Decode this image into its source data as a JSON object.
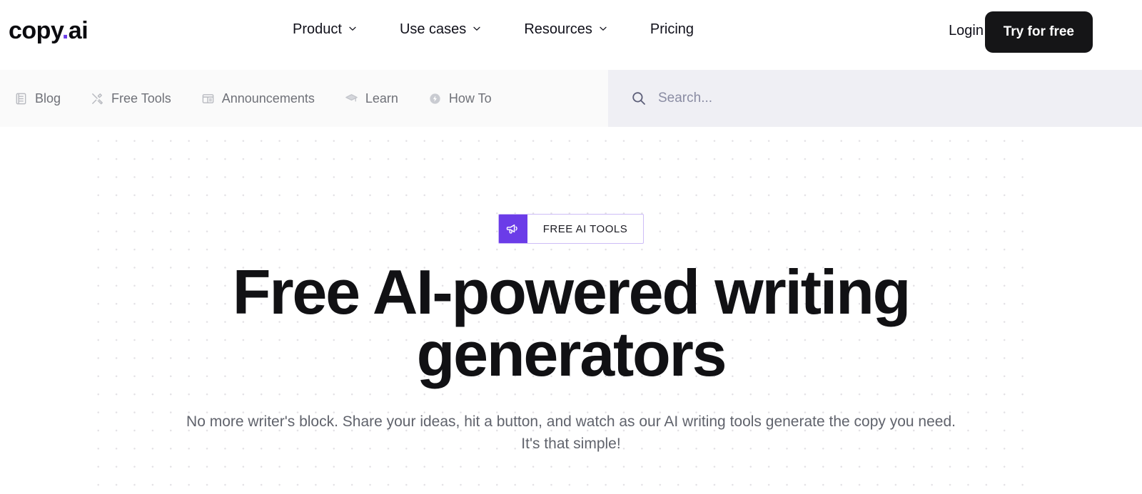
{
  "brand": {
    "name_part1": "copy",
    "dot": ".",
    "name_part2": "ai",
    "accent_color": "#6B3CE8"
  },
  "header": {
    "nav": [
      {
        "label": "Product",
        "has_chevron": true,
        "icon": "chevron-down-icon"
      },
      {
        "label": "Use cases",
        "has_chevron": true,
        "icon": "chevron-down-icon"
      },
      {
        "label": "Resources",
        "has_chevron": true,
        "icon": "chevron-down-icon"
      },
      {
        "label": "Pricing",
        "has_chevron": false,
        "icon": ""
      }
    ],
    "login_label": "Login",
    "cta_label": "Try for free",
    "cta_bg": "#151517",
    "cta_text_color": "#FFFFFF"
  },
  "subnav": {
    "background": "#FAFAFA",
    "items": [
      {
        "label": "Blog",
        "icon": "book-icon"
      },
      {
        "label": "Free Tools",
        "icon": "tools-icon"
      },
      {
        "label": "Announcements",
        "icon": "layout-icon"
      },
      {
        "label": "Learn",
        "icon": "graduation-cap-icon"
      },
      {
        "label": "How To",
        "icon": "lightning-circle-icon"
      }
    ],
    "search": {
      "placeholder": "Search...",
      "value": "",
      "icon": "search-icon",
      "background": "#EFEFF4"
    }
  },
  "hero": {
    "badge": {
      "label": "FREE AI TOOLS",
      "icon": "megaphone-icon",
      "icon_bg": "#6B3CE8",
      "border_color": "#CDBCF7"
    },
    "headline": "Free AI-powered writing generators",
    "subhead": "No more writer's block. Share your ideas, hit a button, and watch as our AI writing tools generate the copy you need. It's that simple!",
    "background": "#FFFFFF",
    "dot_grid_color": "#E2E0E4"
  }
}
